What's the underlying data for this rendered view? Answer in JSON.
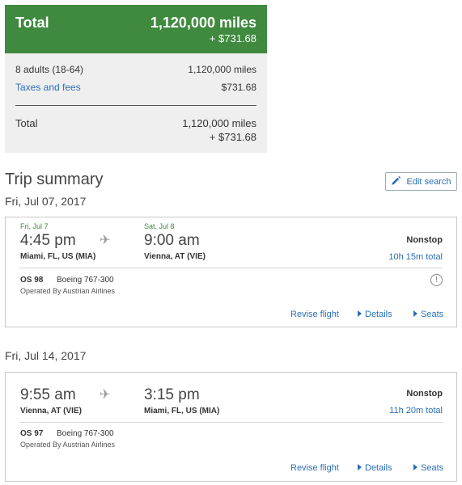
{
  "price": {
    "header_label": "Total",
    "header_miles": "1,120,000 miles",
    "header_cash": "+ $731.68",
    "adults_label": "8 adults (18-64)",
    "adults_value": "1,120,000 miles",
    "taxes_label": "Taxes and fees",
    "taxes_value": "$731.68",
    "total_label": "Total",
    "total_miles": "1,120,000 miles",
    "total_cash": "+ $731.68"
  },
  "trip": {
    "title": "Trip summary",
    "edit_label": "Edit search",
    "edit_icon": "pencil-icon"
  },
  "flights": [
    {
      "date_header": "Fri, Jul 07, 2017",
      "depart_day": "Fri, Jul 7",
      "depart_time": "4:45 pm",
      "depart_place": "Miami, FL, US (MIA)",
      "arrive_day": "Sat, Jul 8",
      "arrive_time": "9:00 am",
      "arrive_place": "Vienna, AT (VIE)",
      "stops": "Nonstop",
      "duration": "10h 15m total",
      "flight_no": "OS 98",
      "aircraft": "Boeing 767-300",
      "operated": "Operated By Austrian Airlines",
      "revise": "Revise flight",
      "details": "Details",
      "seats": "Seats"
    },
    {
      "date_header": "Fri, Jul 14, 2017",
      "depart_time": "9:55 am",
      "depart_place": "Vienna, AT (VIE)",
      "arrive_time": "3:15 pm",
      "arrive_place": "Miami, FL, US (MIA)",
      "stops": "Nonstop",
      "duration": "11h 20m total",
      "flight_no": "OS 97",
      "aircraft": "Boeing 767-300",
      "operated": "Operated By Austrian Airlines",
      "revise": "Revise flight",
      "details": "Details",
      "seats": "Seats"
    }
  ],
  "colors": {
    "accent_green": "#3f8a3e",
    "link_blue": "#2a6fb7"
  }
}
